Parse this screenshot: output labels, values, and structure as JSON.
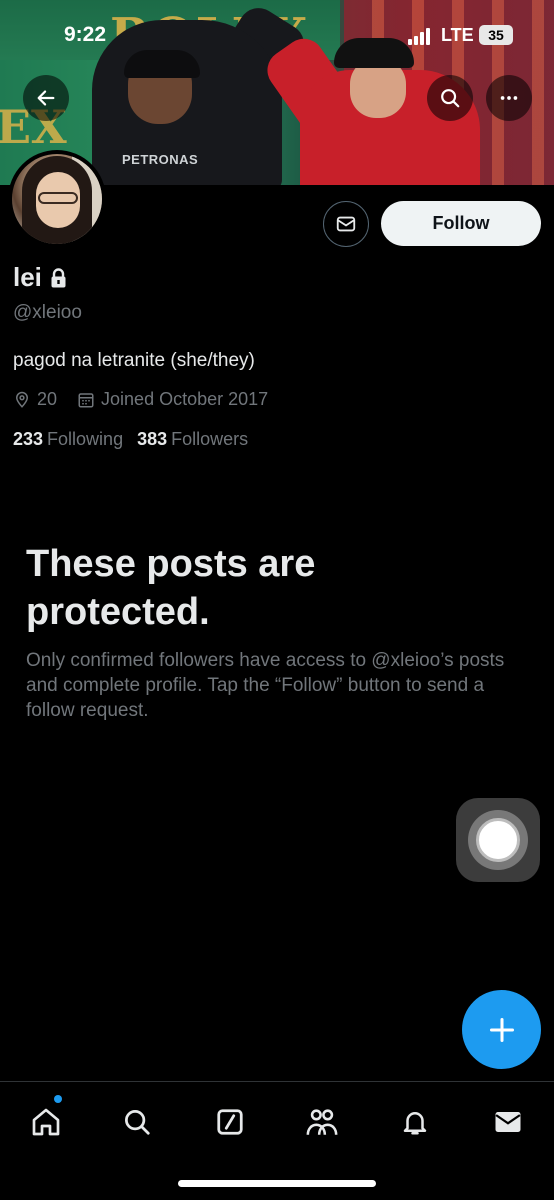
{
  "status_bar": {
    "time": "9:22",
    "network": "LTE",
    "battery": "35"
  },
  "header": {
    "banner_text": "ROLEX",
    "banner_text_2": "EX",
    "banner_jersey_text": "PETRONAS"
  },
  "profile": {
    "name": "lei",
    "handle": "@xleioo",
    "bio": "pagod na letranite (she/they)",
    "location": "20",
    "joined": "Joined October 2017",
    "following_count": "233",
    "following_label": "Following",
    "followers_count": "383",
    "followers_label": "Followers",
    "follow_button": "Follow"
  },
  "protected": {
    "title": "These posts are protected.",
    "body": "Only confirmed followers have access to @xleioo’s posts and complete profile. Tap the “Follow” button to send a follow request."
  },
  "icons": {
    "back": "arrow-left-icon",
    "search": "search-icon",
    "more": "more-icon",
    "lock": "lock-icon",
    "message": "envelope-icon",
    "location": "location-pin-icon",
    "calendar": "calendar-icon",
    "compose": "plus-icon",
    "tabs": [
      "home-icon",
      "search-icon",
      "grok-icon",
      "communities-icon",
      "notifications-icon",
      "messages-icon"
    ]
  },
  "colors": {
    "accent": "#1d9bf0",
    "background": "#000000",
    "secondary_text": "#71767b"
  }
}
